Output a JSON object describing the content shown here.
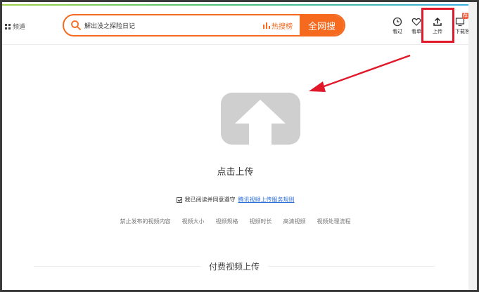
{
  "header": {
    "channel_label": "频道",
    "search_query": "解出没之探险日记",
    "hot_label": "热搜榜",
    "search_button": "全网搜"
  },
  "toolbar": {
    "history_label": "看过",
    "favorites_label": "看单",
    "upload_label": "上传",
    "client_label": "下载客户",
    "client_badge": "荐"
  },
  "upload": {
    "click_label": "点击上传",
    "agree_text": "我已阅读并同意遵守",
    "agree_link": "腾讯视频上传服务规则"
  },
  "rules": [
    "禁止发布的视频内容",
    "视频大小",
    "视频规格",
    "视频时长",
    "高清视频",
    "视频处理流程"
  ],
  "paid_upload_label": "付费视频上传",
  "colors": {
    "accent": "#f56a1f",
    "highlight": "#e0182a",
    "link": "#2b6dd9"
  }
}
